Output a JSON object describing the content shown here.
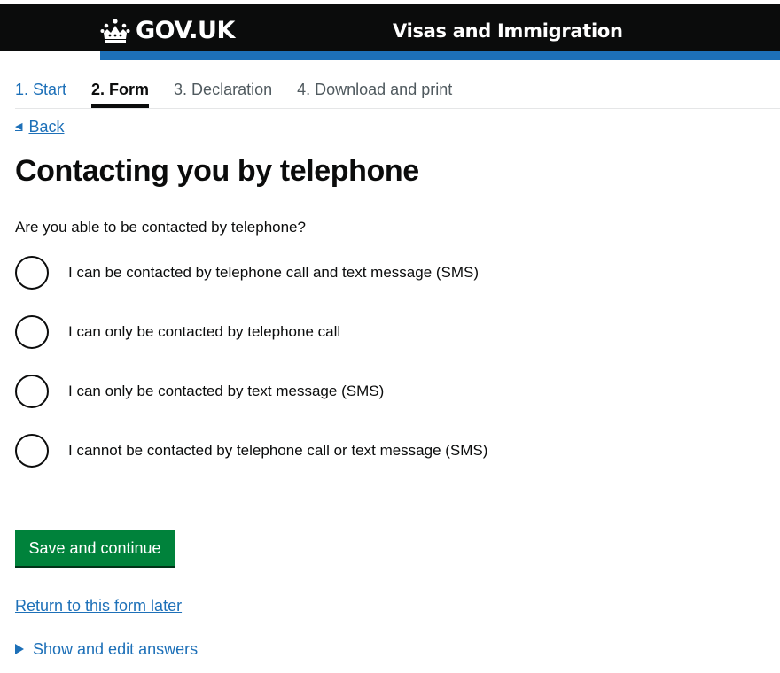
{
  "header": {
    "logo_text": "GOV.UK",
    "service_name": "Visas and Immigration",
    "logo_icon": "crown-icon",
    "background_color": "#0b0c0c",
    "accent_color": "#1d70b8"
  },
  "steps": [
    {
      "label": "1. Start",
      "state": "link"
    },
    {
      "label": "2. Form",
      "state": "active"
    },
    {
      "label": "3. Declaration",
      "state": "inactive"
    },
    {
      "label": "4. Download and print",
      "state": "inactive"
    }
  ],
  "back": {
    "label": "Back",
    "icon": "left-triangle-icon"
  },
  "page_title": "Contacting you by telephone",
  "question": "Are you able to be contacted by telephone?",
  "options": [
    {
      "label": "I can be contacted by telephone call and text message (SMS)",
      "selected": false
    },
    {
      "label": "I can only be contacted by telephone call",
      "selected": false
    },
    {
      "label": "I can only be contacted by text message (SMS)",
      "selected": false
    },
    {
      "label": "I cannot be contacted by telephone call or text message (SMS)",
      "selected": false
    }
  ],
  "save_button": {
    "label": "Save and continue",
    "color": "#00823b"
  },
  "return_link": "Return to this form later",
  "details_toggle": {
    "label": "Show and edit answers",
    "icon": "right-triangle-icon"
  }
}
